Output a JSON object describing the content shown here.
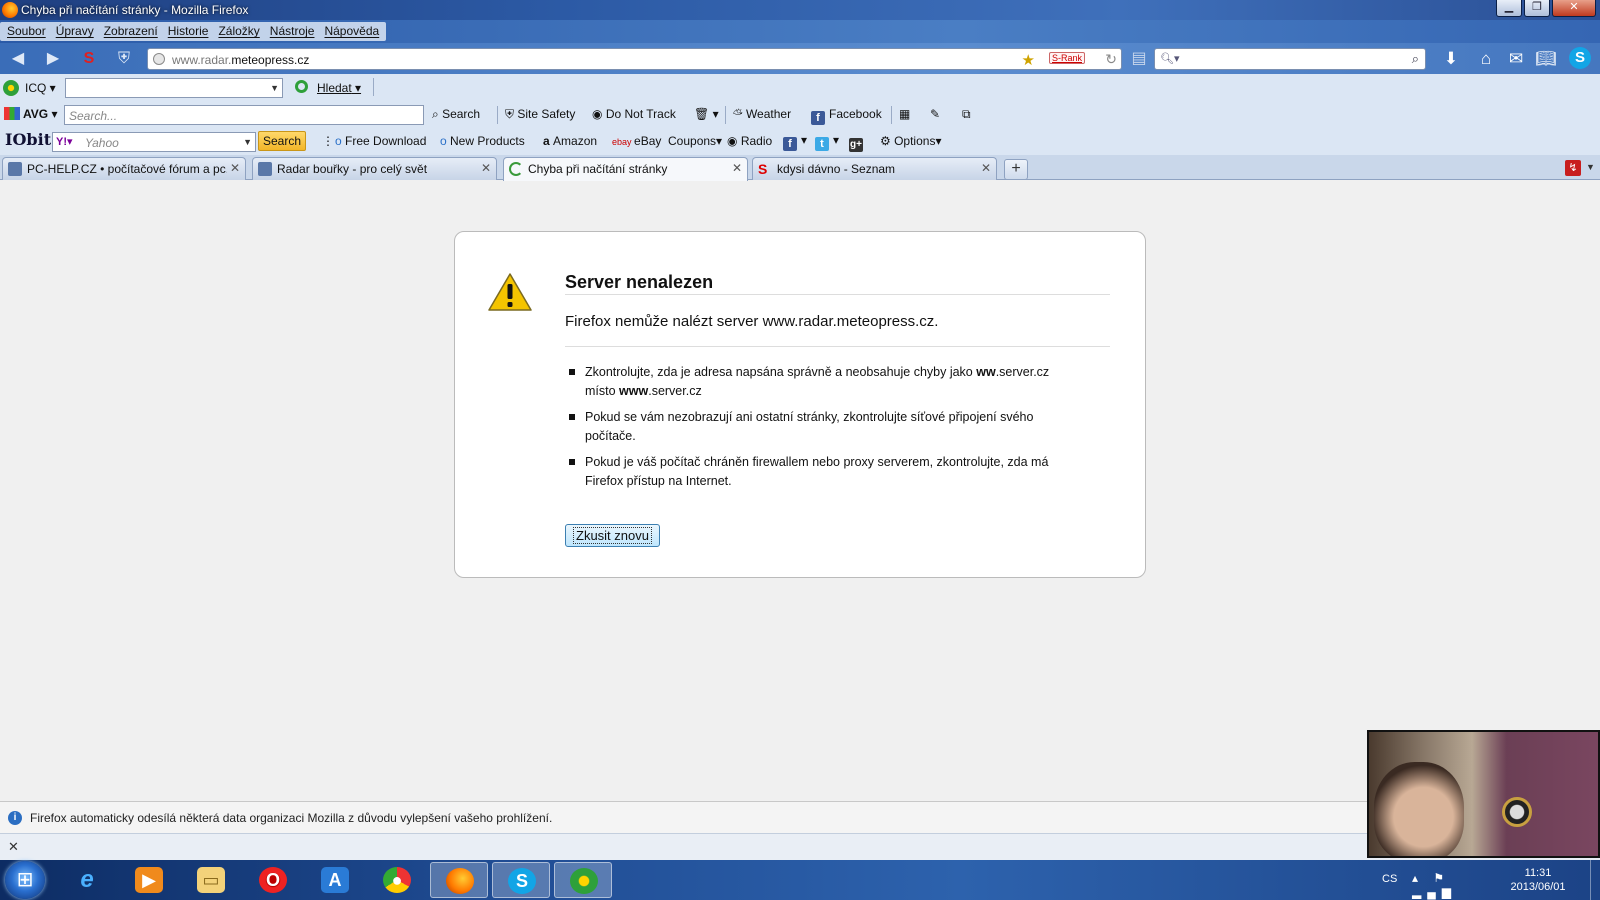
{
  "window": {
    "title": "Chyba při načítání stránky - Mozilla Firefox"
  },
  "menu": [
    "Soubor",
    "Úpravy",
    "Zobrazení",
    "Historie",
    "Záložky",
    "Nástroje",
    "Nápověda"
  ],
  "nav": {
    "url_prefix": "www.radar.",
    "url_domain": "meteopress.cz",
    "srank_label": "S-Rank"
  },
  "toolbar_icq": {
    "label": "ICQ",
    "search_label": "Hledat"
  },
  "toolbar_avg": {
    "logo": "AVG",
    "search_placeholder": "Search...",
    "search_label": "Search",
    "site_safety": "Site Safety",
    "do_not_track": "Do Not Track",
    "weather": "Weather",
    "facebook": "Facebook"
  },
  "toolbar_iobit": {
    "logo": "IObit",
    "yahoo_placeholder": "Yahoo",
    "search_button": "Search",
    "free_download": "Free Download",
    "new_products": "New Products",
    "amazon": "Amazon",
    "ebay": "eBay",
    "coupons": "Coupons",
    "radio": "Radio",
    "options": "Options"
  },
  "tabs": [
    {
      "label": "PC-HELP.CZ • počítačové fórum a pc...",
      "active": false
    },
    {
      "label": "Radar bouřky - pro celý svět",
      "active": false
    },
    {
      "label": "Chyba při načítání stránky",
      "active": true
    },
    {
      "label": "kdysi dávno - Seznam",
      "active": false
    }
  ],
  "error": {
    "title": "Server nenalezen",
    "description": "Firefox nemůže nalézt server www.radar.meteopress.cz.",
    "items": [
      {
        "before": "Zkontrolujte, zda je adresa napsána správně a neobsahuje chyby jako ",
        "bold1": "ww",
        "mid": ".server.cz místo ",
        "bold2": "www",
        "after": ".server.cz"
      },
      {
        "text": "Pokud se vám nezobrazují ani ostatní stránky, zkontrolujte síťové připojení svého počítače."
      },
      {
        "text": "Pokud je váš počítač chráněn firewallem nebo proxy serverem, zkontrolujte, zda má Firefox přístup na Internet."
      }
    ],
    "retry_button": "Zkusit znovu"
  },
  "notification": {
    "text": "Firefox automaticky odesílá některá data organizaci Mozilla z důvodu vylepšení vašeho prohlížení."
  },
  "taskbar": {
    "apps": [
      "internet-explorer",
      "media-player",
      "file-explorer",
      "opera",
      "app-store",
      "chrome",
      "firefox",
      "skype",
      "icq"
    ],
    "lang": "CS",
    "time": "11:31",
    "date": "2013/06/01"
  },
  "colors": {
    "titlebar": "#2c5aa5",
    "toolbar_bg": "#dbe6f4",
    "retry_border": "#3c7fb1",
    "warning_yellow": "#f4c400"
  }
}
